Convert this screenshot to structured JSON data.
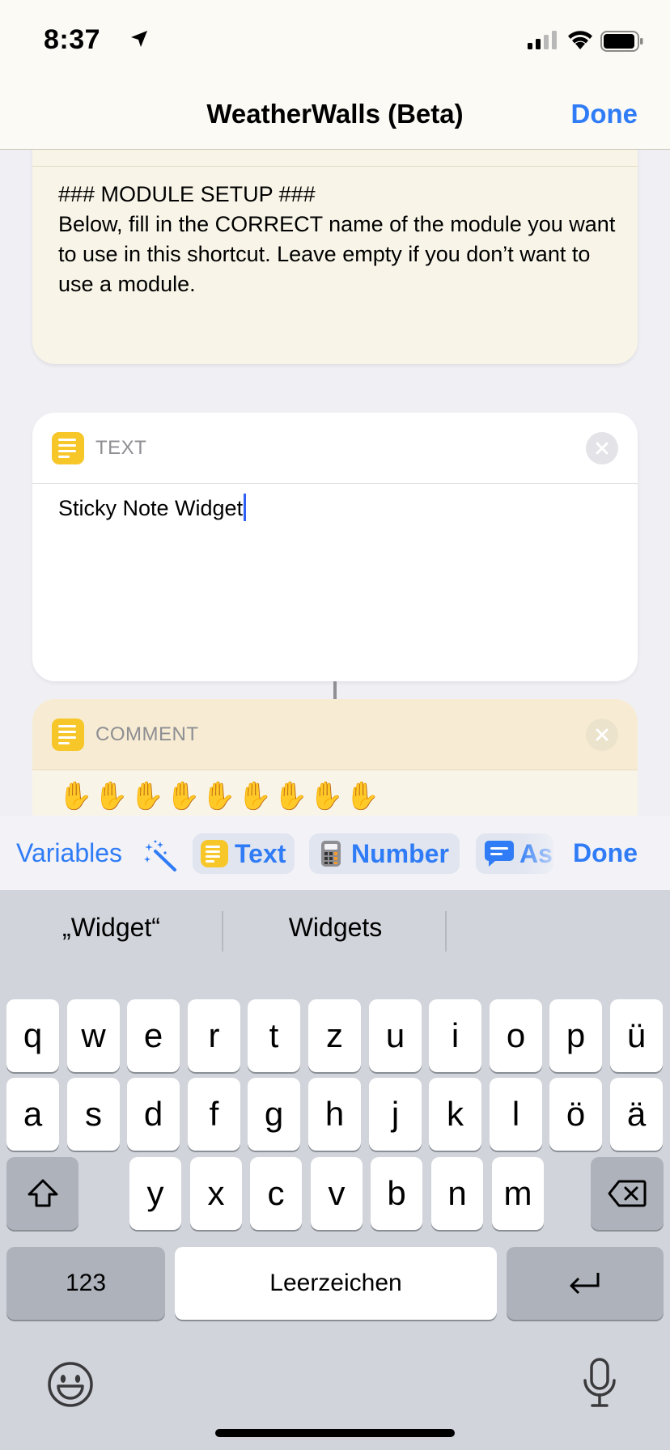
{
  "status_bar": {
    "time": "8:37"
  },
  "nav": {
    "title": "WeatherWalls (Beta)",
    "done_label": "Done"
  },
  "comment_card_1": {
    "text": "### MODULE SETUP ###\nBelow, fill in the CORRECT name of the module you want to use in this shortcut. Leave empty if you don’t want to use a module."
  },
  "text_card": {
    "header_label": "TEXT",
    "value": "Sticky Note Widget"
  },
  "comment_card_2": {
    "header_label": "COMMENT",
    "emojis": "✋✋✋✋✋✋✋✋✋"
  },
  "toolbar": {
    "variables_label": "Variables",
    "text_label": "Text",
    "number_label": "Number",
    "ask_label": "As",
    "done_label": "Done"
  },
  "keyboard": {
    "suggestions": [
      "„Widget“",
      "Widgets"
    ],
    "row1": [
      "q",
      "w",
      "e",
      "r",
      "t",
      "z",
      "u",
      "i",
      "o",
      "p",
      "ü"
    ],
    "row2": [
      "a",
      "s",
      "d",
      "f",
      "g",
      "h",
      "j",
      "k",
      "l",
      "ö",
      "ä"
    ],
    "row3": [
      "y",
      "x",
      "c",
      "v",
      "b",
      "n",
      "m"
    ],
    "numbers_label": "123",
    "space_label": "Leerzeichen"
  },
  "colors": {
    "accent": "#2f7cf6",
    "app_icon": "#f7c72a",
    "comment_bg": "#f8f5e8"
  }
}
